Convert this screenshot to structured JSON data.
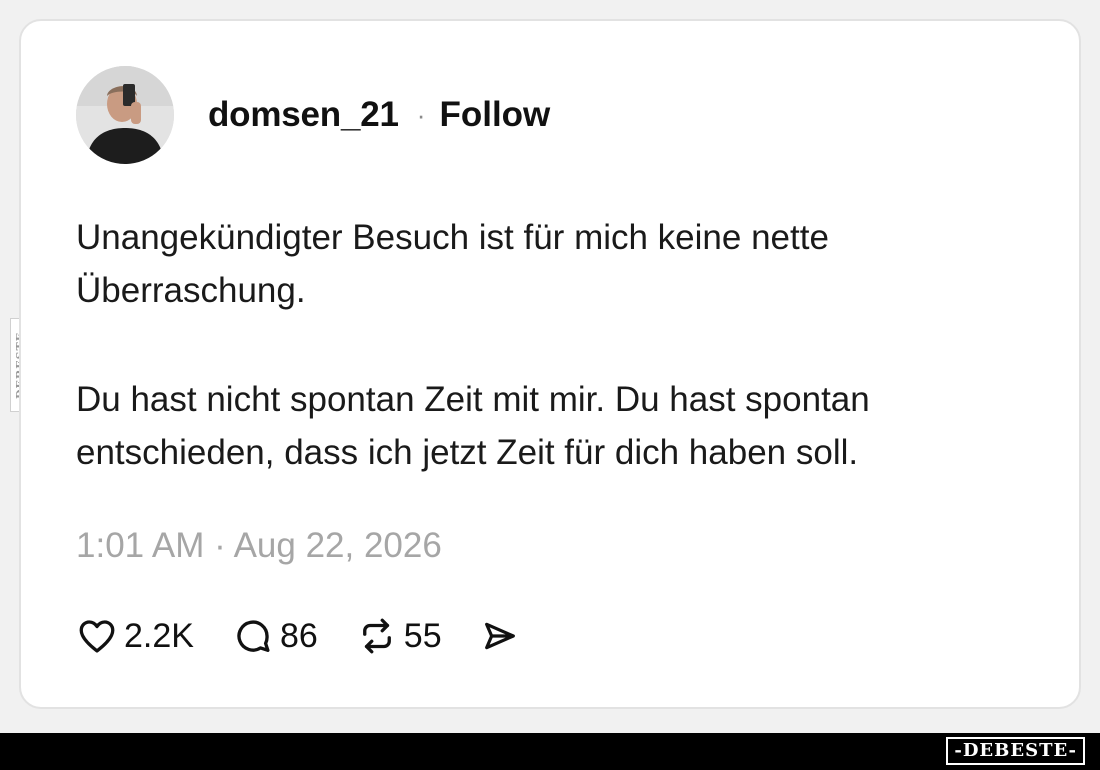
{
  "post": {
    "username": "domsen_21",
    "separator": "·",
    "follow_label": "Follow",
    "paragraphs": [
      "Unangekündigter Besuch ist für mich keine nette Überraschung.",
      "Du hast nicht spontan Zeit mit mir. Du hast spontan entschieden, dass ich jetzt Zeit für dich haben soll."
    ],
    "timestamp": "1:01 AM · Aug 22, 2026",
    "stats": {
      "likes": "2.2K",
      "comments": "86",
      "reposts": "55"
    }
  },
  "icons": {
    "like": "heart-icon",
    "comment": "speech-bubble-icon",
    "repost": "repost-arrows-icon",
    "share": "send-icon"
  },
  "watermark": {
    "brand": "-DEBESTE-",
    "side": "DEBESTE"
  },
  "colors": {
    "text": "#111111",
    "timestamp": "#a6a6a6",
    "card_border": "#e2e2e2",
    "bar": "#000000"
  }
}
